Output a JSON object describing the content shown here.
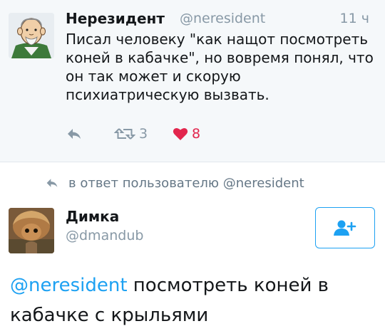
{
  "parent_tweet": {
    "author_name": "Нерезидент",
    "author_handle": "@neresident",
    "time": "11 ч",
    "text": "Писал человеку \"как нащот посмотреть коней в кабачке\", но вовремя понял, что он так может и скорую психиатрическую вызвать.",
    "retweet_count": "3",
    "like_count": "8"
  },
  "reply_context": {
    "text": "в ответ пользователю @neresident"
  },
  "tweet": {
    "author_name": "Димка",
    "author_handle": "@dmandub",
    "mention": "@neresident",
    "text": " посмотреть коней в кабачке с крыльями"
  },
  "colors": {
    "accent": "#1da1f2",
    "like": "#e2264d",
    "muted": "#8899a6"
  },
  "icons": {
    "reply": "reply-arrow-icon",
    "retweet": "retweet-icon",
    "like": "heart-icon",
    "follow": "add-user-icon"
  }
}
